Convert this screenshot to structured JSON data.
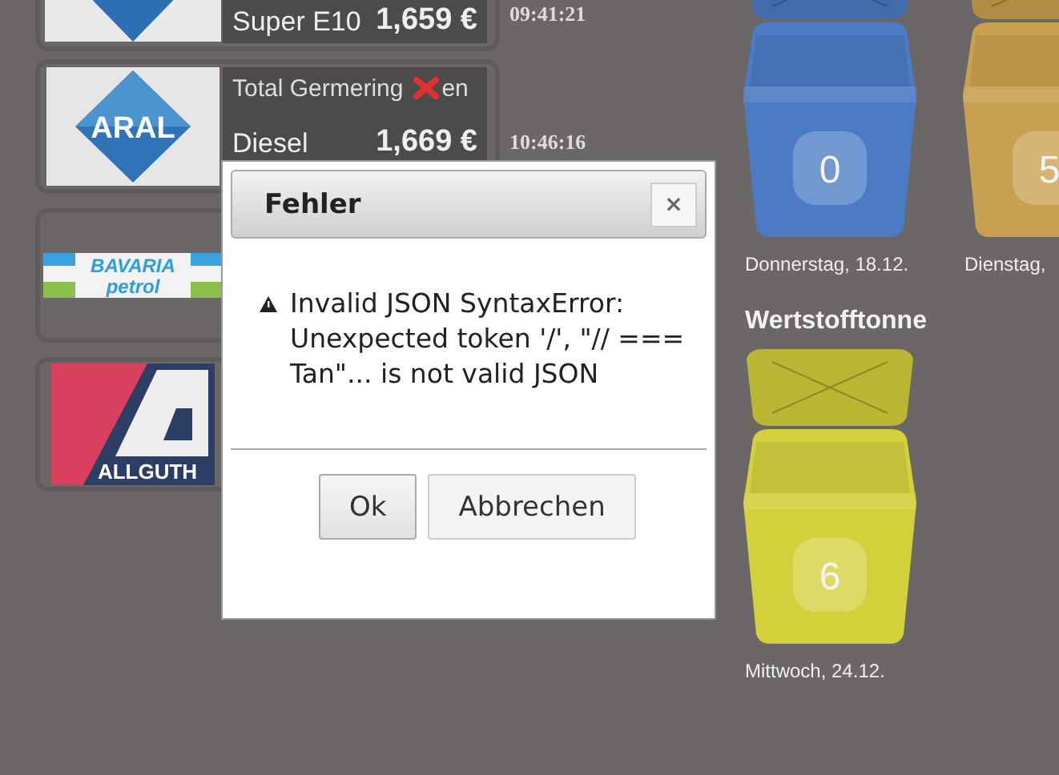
{
  "stations": [
    {
      "logo": {
        "kind": "diamond"
      },
      "fuel": "Super E10",
      "price": "1,659 €",
      "time": "09:41:21"
    },
    {
      "logo": {
        "kind": "aral",
        "text": "ARAL"
      },
      "name": "Total Germering",
      "fuel": "Diesel",
      "price": "1,669 €",
      "time": "10:46:16",
      "status": "en",
      "status_icon": true
    },
    {
      "logo": {
        "kind": "bavaria",
        "text": "BAVARIA",
        "subtext": "petrol"
      }
    },
    {
      "logo": {
        "kind": "allguth",
        "text": "ALLGUTH"
      }
    }
  ],
  "bins": [
    {
      "count": "0",
      "date": "Donnerstag, 18.12.",
      "color": "#4a7bc4"
    },
    {
      "count": "5",
      "date": "Dienstag,",
      "color": "#c9a04f"
    },
    {
      "title": "Wertstofftonne",
      "count": "6",
      "date": "Mittwoch, 24.12.",
      "color": "#d4d03c"
    }
  ],
  "dialog": {
    "title": "Fehler",
    "close": "×",
    "message": "Invalid JSON SyntaxError: Unexpected token '/', \"// === Tan\"... is not valid JSON",
    "buttons": [
      "Ok",
      "Abbrechen"
    ]
  }
}
